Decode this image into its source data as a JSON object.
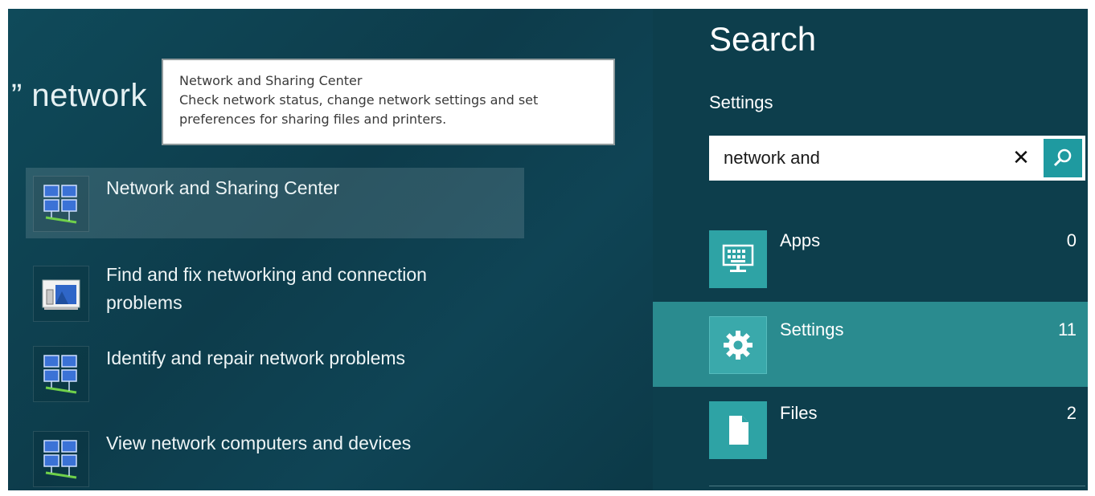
{
  "query": "” network",
  "tooltip": {
    "title": "Network and Sharing Center",
    "description": "Check network status, change network settings and set preferences for sharing files and printers."
  },
  "results": [
    {
      "label": "Network and Sharing Center",
      "icon": "network-center-icon"
    },
    {
      "label": "Find and fix networking and connection problems",
      "icon": "troubleshoot-icon"
    },
    {
      "label": "Identify and repair network problems",
      "icon": "network-center-icon"
    },
    {
      "label": "View network computers and devices",
      "icon": "network-center-icon"
    }
  ],
  "charm": {
    "title": "Search",
    "scope": "Settings",
    "search_value": "network and",
    "clear_glyph": "✕",
    "categories": [
      {
        "label": "Apps",
        "count": "0",
        "icon": "keyboard-icon"
      },
      {
        "label": "Settings",
        "count": "11",
        "icon": "gear-icon"
      },
      {
        "label": "Files",
        "count": "2",
        "icon": "document-icon"
      }
    ]
  },
  "colors": {
    "background": "#0f3e4c",
    "accent": "#2ea3a5",
    "selected": "#2a8b8f"
  }
}
